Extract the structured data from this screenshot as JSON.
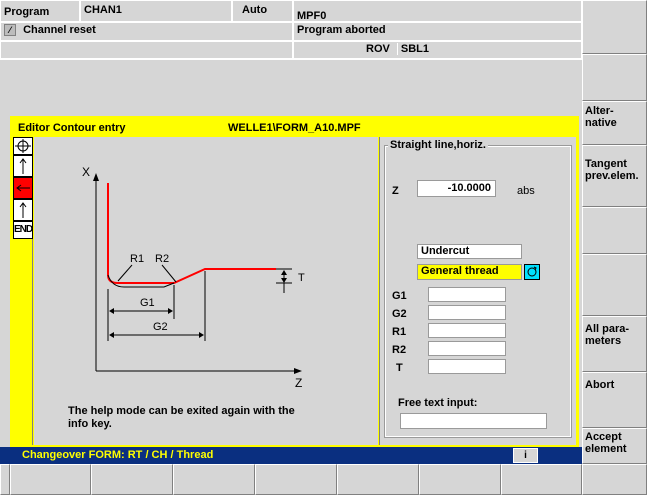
{
  "header": {
    "area": "Program",
    "channel": "CHAN1",
    "mode": "Auto",
    "program_name": "MPF0",
    "channel_status": "Channel reset",
    "program_status": "Program aborted",
    "rov": "ROV",
    "sbl": "SBL1"
  },
  "editor": {
    "title_left": "Editor  Contour entry",
    "file_path": "WELLE1\\FORM_A10.MPF",
    "sidebar_end": "END"
  },
  "diagram": {
    "x_axis": "X",
    "z_axis": "Z",
    "r1": "R1",
    "r2": "R2",
    "t": "T",
    "g1": "G1",
    "g2": "G2"
  },
  "help_text_line1": "The help mode can be exited again with the",
  "help_text_line2": "info key.",
  "form": {
    "group_title": "Straight line,horiz.",
    "z_label": "Z",
    "z_value": "-10.0000",
    "z_unit": "abs",
    "undercut": "Undercut",
    "thread": "General thread",
    "g1": "G1",
    "g2": "G2",
    "r1": "R1",
    "r2": "R2",
    "t": "T",
    "g1_value": "",
    "g2_value": "",
    "r1_value": "",
    "r2_value": "",
    "t_value": "",
    "free_text_label": "Free text input:",
    "free_text_value": ""
  },
  "status_bar": {
    "message": "Changeover FORM: RT / CH / Thread",
    "info": "i"
  },
  "softkeys": [
    {
      "line1": "Alter-",
      "line2": "native"
    },
    {
      "line1": "Tangent",
      "line2": "prev.elem."
    },
    {
      "line1": "",
      "line2": ""
    },
    {
      "line1": "",
      "line2": ""
    },
    {
      "line1": "All para-",
      "line2": "meters"
    },
    {
      "line1": "Abort",
      "line2": ""
    },
    {
      "line1": "Accept",
      "line2": "element"
    }
  ],
  "colors": {
    "yellow": "#ffff00",
    "navy_bar": "#0a2f80",
    "contour_red": "#ff0000",
    "cyan_toggle": "#00e0ff"
  }
}
